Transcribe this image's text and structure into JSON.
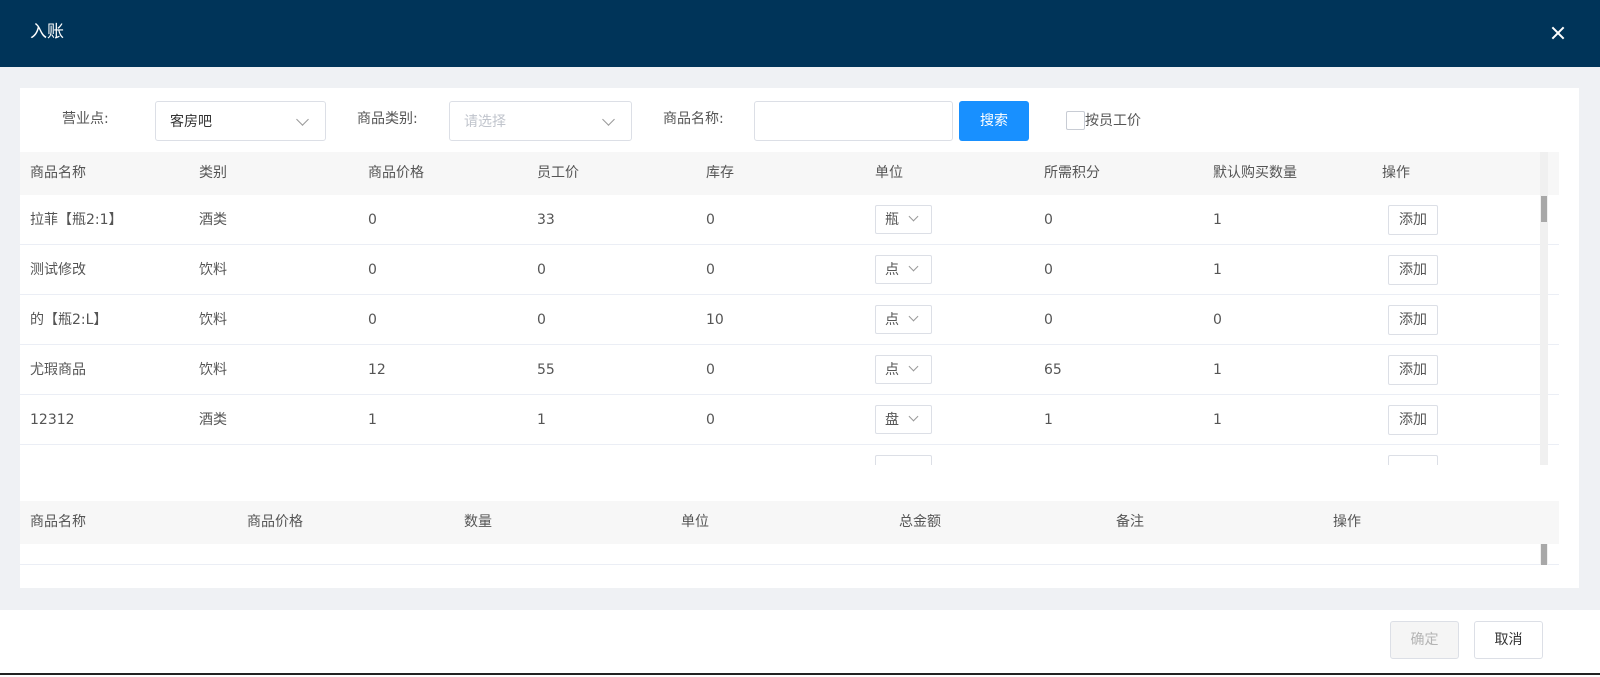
{
  "dialog": {
    "title": "入账",
    "close_icon": "close-icon"
  },
  "filters": {
    "business_point_label": "营业点:",
    "business_point_value": "客房吧",
    "category_label": "商品类别:",
    "category_placeholder": "请选择",
    "product_name_label": "商品名称:",
    "product_name_value": "",
    "search_label": "搜索",
    "employee_price_checkbox_label": "按员工价",
    "employee_price_checked": false
  },
  "products_table": {
    "headers": [
      "商品名称",
      "类别",
      "商品价格",
      "员工价",
      "库存",
      "单位",
      "所需积分",
      "默认购买数量",
      "操作"
    ],
    "rows": [
      {
        "name": "拉菲【瓶2:1】",
        "category": "酒类",
        "price": "0",
        "staff_price": "33",
        "stock": "0",
        "unit": "瓶",
        "points": "0",
        "default_qty": "1",
        "action": "添加"
      },
      {
        "name": "测试修改",
        "category": "饮料",
        "price": "0",
        "staff_price": "0",
        "stock": "0",
        "unit": "点",
        "points": "0",
        "default_qty": "1",
        "action": "添加"
      },
      {
        "name": "的【瓶2:L】",
        "category": "饮料",
        "price": "0",
        "staff_price": "0",
        "stock": "10",
        "unit": "点",
        "points": "0",
        "default_qty": "0",
        "action": "添加"
      },
      {
        "name": "尤瑕商品",
        "category": "饮料",
        "price": "12",
        "staff_price": "55",
        "stock": "0",
        "unit": "点",
        "points": "65",
        "default_qty": "1",
        "action": "添加"
      },
      {
        "name": "12312",
        "category": "酒类",
        "price": "1",
        "staff_price": "1",
        "stock": "0",
        "unit": "盘",
        "points": "1",
        "default_qty": "1",
        "action": "添加"
      }
    ]
  },
  "selected_table": {
    "headers": [
      "商品名称",
      "商品价格",
      "数量",
      "单位",
      "总金额",
      "备注",
      "操作"
    ],
    "rows": []
  },
  "footer": {
    "confirm_label": "确定",
    "cancel_label": "取消"
  },
  "colors": {
    "header_bg": "#003459",
    "primary": "#1890ff",
    "body_bg": "#eff1f4"
  }
}
